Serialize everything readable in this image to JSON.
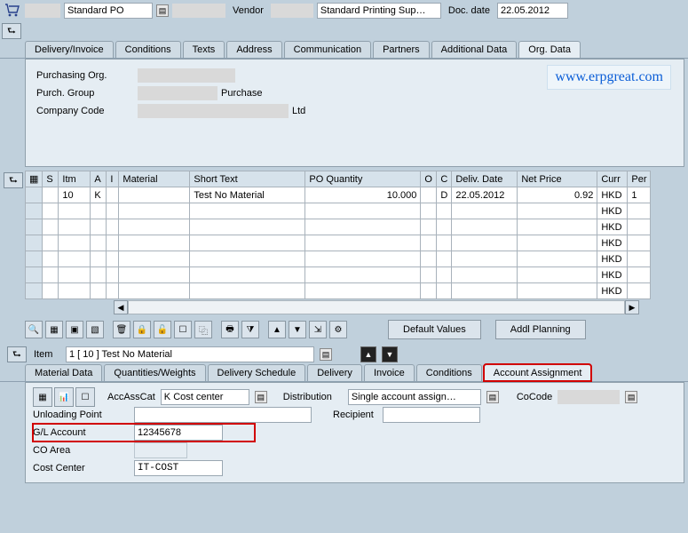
{
  "header": {
    "doc_type": "Standard PO",
    "vendor_label": "Vendor",
    "vendor_name": "Standard Printing Sup…",
    "doc_date_label": "Doc. date",
    "doc_date": "22.05.2012"
  },
  "tabs": [
    "Delivery/Invoice",
    "Conditions",
    "Texts",
    "Address",
    "Communication",
    "Partners",
    "Additional Data",
    "Org. Data"
  ],
  "active_tab": "Org. Data",
  "org": {
    "purch_org_label": "Purchasing Org.",
    "purch_group_label": "Purch. Group",
    "purch_group_text": "Purchase",
    "company_code_label": "Company Code",
    "company_code_text": "Ltd"
  },
  "watermark": "www.erpgreat.com",
  "grid": {
    "cols": [
      "S",
      "Itm",
      "A",
      "I",
      "Material",
      "Short Text",
      "PO Quantity",
      "O",
      "C",
      "Deliv. Date",
      "Net Price",
      "Curr",
      "Per"
    ],
    "rows": [
      {
        "s": "",
        "itm": "10",
        "a": "K",
        "i": "",
        "material": "",
        "short": "Test No Material",
        "qty": "10.000",
        "o": "",
        "c": "D",
        "deliv": "22.05.2012",
        "price": "0.92",
        "curr": "HKD",
        "per": "1"
      },
      {
        "curr": "HKD"
      },
      {
        "curr": "HKD"
      },
      {
        "curr": "HKD"
      },
      {
        "curr": "HKD"
      },
      {
        "curr": "HKD"
      },
      {
        "curr": "HKD"
      }
    ]
  },
  "toolbar_buttons": [
    "Default Values",
    "Addl Planning"
  ],
  "item_sel": {
    "label": "Item",
    "value": "1 [ 10 ] Test No Material"
  },
  "tabs2": [
    "Material Data",
    "Quantities/Weights",
    "Delivery Schedule",
    "Delivery",
    "Invoice",
    "Conditions",
    "Account Assignment"
  ],
  "active_tab2": "Account Assignment",
  "acc": {
    "accasscat_label": "AccAssCat",
    "accasscat_value": "K Cost center",
    "distribution_label": "Distribution",
    "distribution_value": "Single account assign…",
    "cocode_label": "CoCode",
    "unloading_label": "Unloading Point",
    "recipient_label": "Recipient",
    "gl_label": "G/L Account",
    "gl_value": "12345678",
    "coarea_label": "CO Area",
    "costcenter_label": "Cost Center",
    "costcenter_value": "IT-COST"
  }
}
